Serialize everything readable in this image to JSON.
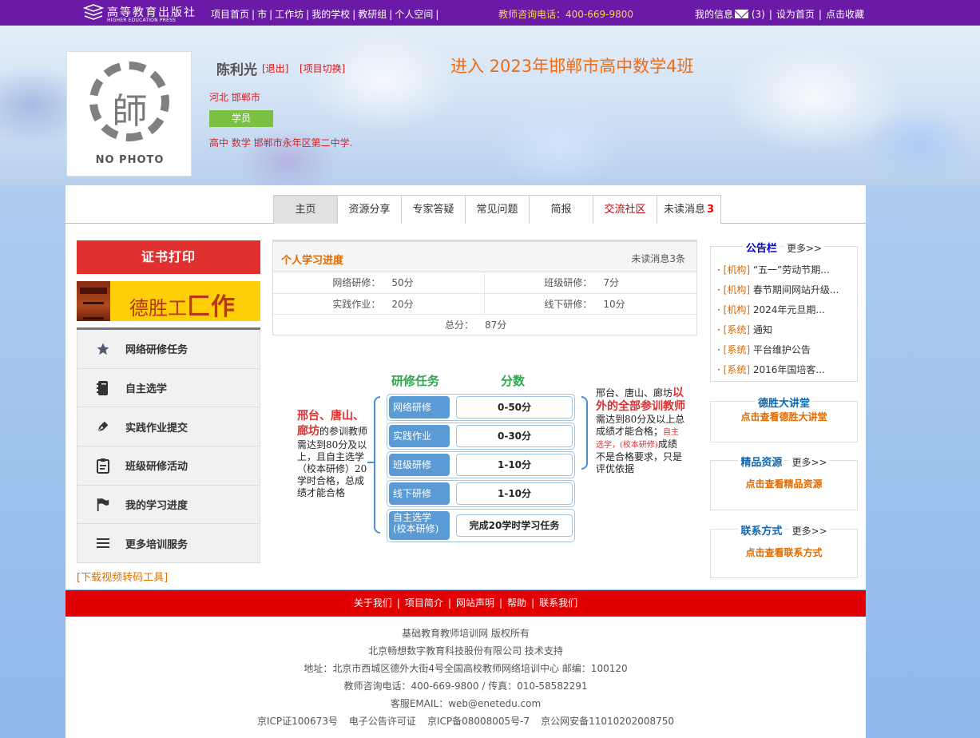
{
  "topbar": {
    "logo_cn": "高等教育出版社",
    "logo_en": "HIGHER EDUCATION PRESS",
    "nav": [
      "项目首页",
      "市",
      "工作坊",
      "我的学校",
      "教研组",
      "个人空间"
    ],
    "nav_trailing_sep": "|",
    "hotline": "教师咨询电话：400-669-9800",
    "my_info": "我的信息",
    "msg_count": "(3)",
    "set_home": "设为首页",
    "favorite": "点击收藏"
  },
  "profile": {
    "photo_glyph": "師",
    "no_photo": "NO PHOTO",
    "name": "陈利光",
    "logout": "[退出]",
    "switch_project": "[项目切换]",
    "region": "河北 邯郸市",
    "role": "学员",
    "school": "高中 数学 邯郸市永年区第二中学."
  },
  "class_title": "进入  2023年邯郸市高中数学4班",
  "tabs": [
    {
      "label": "主页",
      "active": true
    },
    {
      "label": "资源分享"
    },
    {
      "label": "专家答疑"
    },
    {
      "label": "常见问题"
    },
    {
      "label": "简报"
    },
    {
      "label": "交流社区",
      "red": true
    },
    {
      "label": "未读消息",
      "count": "3"
    }
  ],
  "left": {
    "cert_print": "证书打印",
    "desheng_a": "德胜工",
    "desheng_b": "匚作",
    "menu": [
      {
        "label": "网络研修任务",
        "icon": "star-icon"
      },
      {
        "label": "自主选学",
        "icon": "notebook-icon"
      },
      {
        "label": "实践作业提交",
        "icon": "pen-icon"
      },
      {
        "label": "班级研修活动",
        "icon": "clipboard-icon"
      },
      {
        "label": "我的学习进度",
        "icon": "flag-icon"
      },
      {
        "label": "更多培训服务",
        "icon": "menu-icon"
      }
    ],
    "download_tool": "[下载视频转码工具]"
  },
  "progress": {
    "title": "个人学习进度",
    "unread": "未读消息3条",
    "rows": [
      [
        {
          "k": "网络研修：",
          "v": "50分"
        },
        {
          "k": "班级研修：",
          "v": "7分"
        }
      ],
      [
        {
          "k": "实践作业：",
          "v": "20分"
        },
        {
          "k": "线下研修：",
          "v": "10分"
        }
      ]
    ],
    "total_label": "总分：",
    "total_value": "87分"
  },
  "diagram": {
    "col1": "研修任务",
    "col2": "分数",
    "left_em": "邢台、唐山、廊坊",
    "left_text": "的参训教师需达到80分及以上，且自主选学（校本研修）20学时合格，总成绩才能合格",
    "rows": [
      {
        "name": "网络研修",
        "score": "0-50分"
      },
      {
        "name": "实践作业",
        "score": "0-30分"
      },
      {
        "name": "班级研修",
        "score": "1-10分"
      },
      {
        "name": "线下研修",
        "score": "1-10分"
      },
      {
        "name": "自主选学",
        "name2": "(校本研修)",
        "score": "完成20学时学习任务"
      }
    ],
    "right_a": "邢台、唐山、廊坊",
    "right_em": "以外的全部参训教师",
    "right_b": "需达到80分及以上总成绩才能合格；",
    "right_small": "自主选学，(校本研修)",
    "right_c": "成绩不是合格要求，只是评优依据"
  },
  "right": {
    "notice_title": "公告栏",
    "more": "更多>>",
    "notices": [
      {
        "tag": "[机构]",
        "text": "“五一”劳动节期..."
      },
      {
        "tag": "[机构]",
        "text": "春节期间网站升级..."
      },
      {
        "tag": "[机构]",
        "text": "2024年元旦期..."
      },
      {
        "tag": "[系统]",
        "text": "通知"
      },
      {
        "tag": "[系统]",
        "text": "平台维护公告"
      },
      {
        "tag": "[系统]",
        "text": "2016年国培客..."
      }
    ],
    "lecture_title": "德胜大讲堂",
    "lecture_link": "点击查看德胜大讲堂",
    "resource_title": "精品资源",
    "resource_link": "点击查看精品资源",
    "contact_title": "联系方式",
    "contact_link": "点击查看联系方式"
  },
  "footer": {
    "nav": [
      "关于我们",
      "项目简介",
      "网站声明",
      "帮助",
      "联系我们"
    ],
    "copyright": "基础教育教师培训网 版权所有",
    "support": "北京畅想数字教育科技股份有限公司 技术支持",
    "address": "地址：北京市西城区德外大街4号全国高校教师网络培训中心 邮编：100120",
    "phone": "教师咨询电话：400-669-9800 / 传真：010-58582291",
    "email": "客服EMAIL：web@enetedu.com",
    "icp": [
      "京ICP证100673号",
      "电子公告许可证",
      "京ICP备08008005号-7",
      "京公网安备11010202008750"
    ]
  },
  "colors": {
    "topbar": "#6a1aa6",
    "accent_red": "#e0302f",
    "orange": "#e06a00",
    "green": "#7bc043",
    "blue": "#5b9bd5"
  }
}
